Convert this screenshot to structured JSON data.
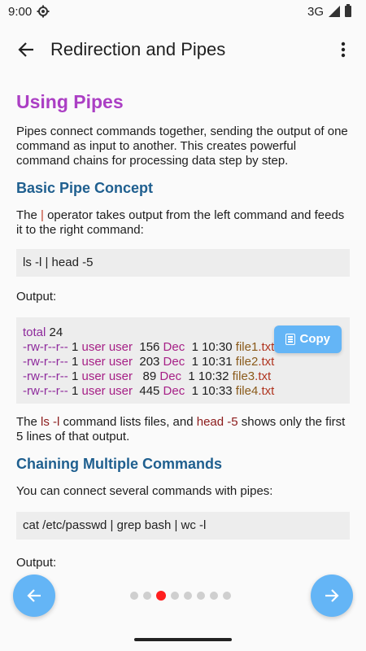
{
  "status_bar": {
    "time": "9:00",
    "network": "3G",
    "icons": [
      "settings-gear-icon",
      "signal-icon",
      "battery-icon"
    ]
  },
  "app_bar": {
    "title": "Redirection and Pipes",
    "back_icon": "arrow-left-icon",
    "menu_icon": "more-vert-icon"
  },
  "content": {
    "heading": "Using Pipes",
    "intro": "Pipes connect commands together, sending the output of one command as input to another. This creates powerful command chains for processing data step by step.",
    "section1": {
      "title": "Basic Pipe Concept",
      "text_before": "The ",
      "operator": "|",
      "text_after": " operator takes output from the left command and feeds it to the right command:",
      "command": "ls -l | head -5",
      "output_label": "Output:",
      "output_lines": [
        {
          "perm": "total",
          "rest": " 24",
          "user": "",
          "size": "",
          "mon": "",
          "time": "",
          "file": "",
          "ext": ""
        },
        {
          "perm": "-rw-r--r--",
          "rest": " 1 ",
          "user": "user user",
          "size": "  156 ",
          "mon": "Dec",
          "time": "  1 10:30 ",
          "file": "file1",
          "ext": ".txt"
        },
        {
          "perm": "-rw-r--r--",
          "rest": " 1 ",
          "user": "user user",
          "size": "  203 ",
          "mon": "Dec",
          "time": "  1 10:31 ",
          "file": "file2",
          "ext": ".txt"
        },
        {
          "perm": "-rw-r--r--",
          "rest": " 1 ",
          "user": "user user",
          "size": "   89 ",
          "mon": "Dec",
          "time": "  1 10:32 ",
          "file": "file3",
          "ext": ".txt"
        },
        {
          "perm": "-rw-r--r--",
          "rest": " 1 ",
          "user": "user user",
          "size": "  445 ",
          "mon": "Dec",
          "time": "  1 10:33 ",
          "file": "file4",
          "ext": ".txt"
        }
      ],
      "copy_label": "Copy",
      "explain_1": "The ",
      "explain_cmd1": "ls -l",
      "explain_2": " command lists files, and ",
      "explain_cmd2": "head -5",
      "explain_3": " shows only the first 5 lines of that output."
    },
    "section2": {
      "title": "Chaining Multiple Commands",
      "text": "You can connect several commands with pipes:",
      "command": "cat /etc/passwd | grep bash | wc -l",
      "output_label": "Output:"
    }
  },
  "pager": {
    "total": 8,
    "current": 3,
    "prev_icon": "arrow-left-icon",
    "next_icon": "arrow-right-icon"
  },
  "colors": {
    "accent": "#64b5f6",
    "heading": "#ab3fc4",
    "subheading": "#1f5f8f",
    "active_dot": "#ff1f1f"
  }
}
